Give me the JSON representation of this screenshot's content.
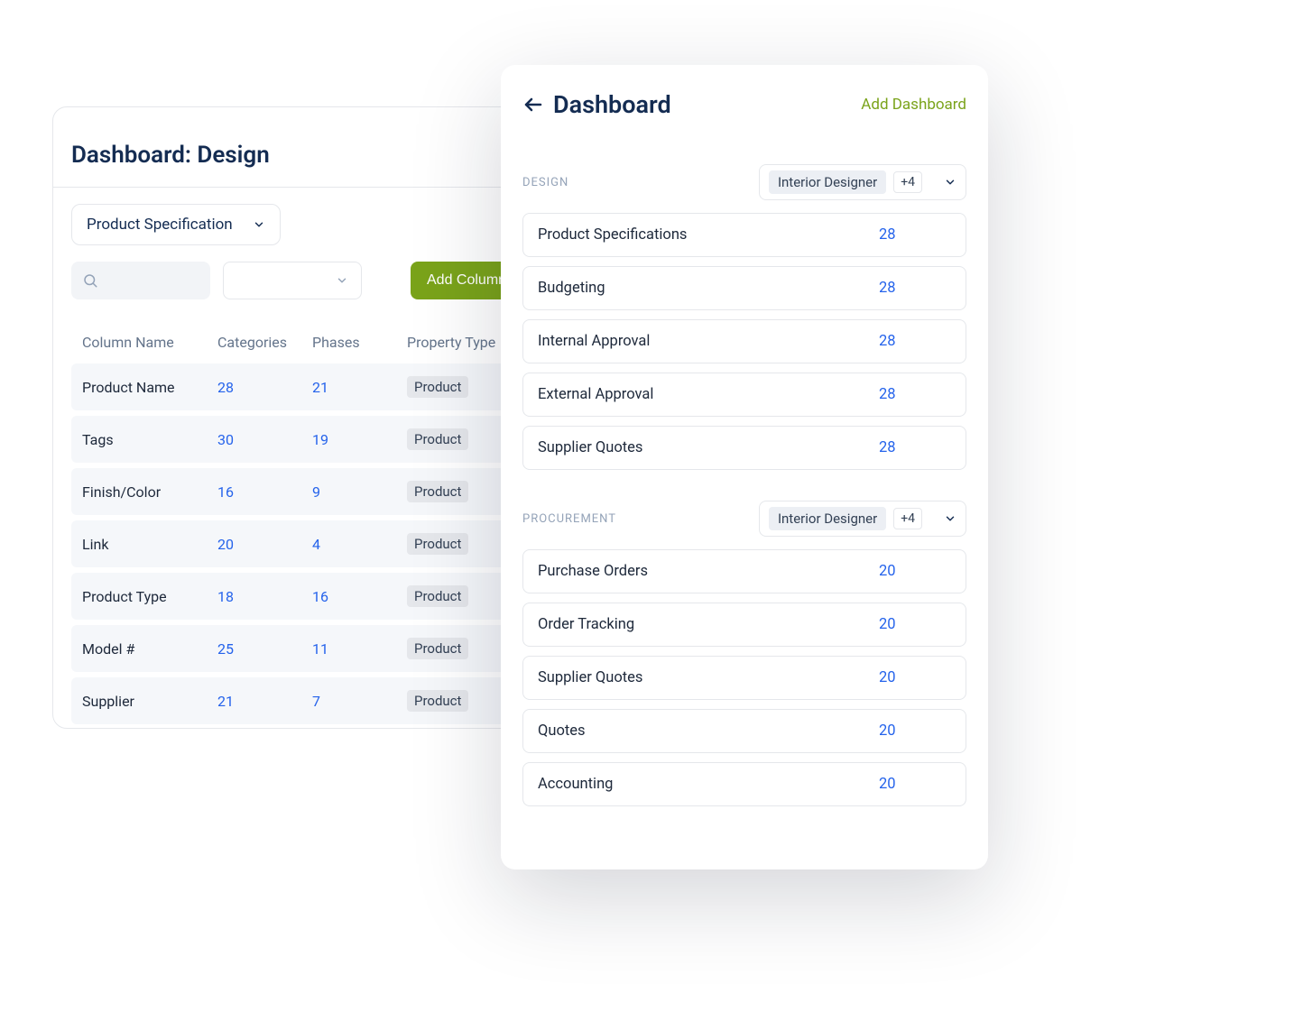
{
  "left": {
    "title": "Dashboard: Design",
    "breadcrumb": "Dashboard",
    "dropdown_label": "Product Specification",
    "add_column_label": "Add Column",
    "table": {
      "headers": {
        "col1": "Column Name",
        "col2": "Categories",
        "col3": "Phases",
        "col4": "Property Type"
      },
      "rows": [
        {
          "name": "Product Name",
          "categories": "28",
          "phases": "21",
          "type": "Product"
        },
        {
          "name": "Tags",
          "categories": "30",
          "phases": "19",
          "type": "Product"
        },
        {
          "name": "Finish/Color",
          "categories": "16",
          "phases": "9",
          "type": "Product"
        },
        {
          "name": "Link",
          "categories": "20",
          "phases": "4",
          "type": "Product"
        },
        {
          "name": "Product Type",
          "categories": "18",
          "phases": "16",
          "type": "Product"
        },
        {
          "name": "Model #",
          "categories": "25",
          "phases": "11",
          "type": "Product"
        },
        {
          "name": "Supplier",
          "categories": "21",
          "phases": "7",
          "type": "Product"
        }
      ]
    }
  },
  "right": {
    "title": "Dashboard",
    "add_label": "Add Dashboard",
    "sections": [
      {
        "label": "DESIGN",
        "chip": "Interior Designer",
        "more": "+4",
        "rows": [
          {
            "name": "Product Specifications",
            "count": "28"
          },
          {
            "name": "Budgeting",
            "count": "28"
          },
          {
            "name": "Internal Approval",
            "count": "28"
          },
          {
            "name": "External Approval",
            "count": "28"
          },
          {
            "name": "Supplier Quotes",
            "count": "28"
          }
        ]
      },
      {
        "label": "PROCUREMENT",
        "chip": "Interior Designer",
        "more": "+4",
        "rows": [
          {
            "name": "Purchase Orders",
            "count": "20"
          },
          {
            "name": "Order Tracking",
            "count": "20"
          },
          {
            "name": "Supplier Quotes",
            "count": "20"
          },
          {
            "name": "Quotes",
            "count": "20"
          },
          {
            "name": "Accounting",
            "count": "20"
          }
        ]
      }
    ]
  }
}
